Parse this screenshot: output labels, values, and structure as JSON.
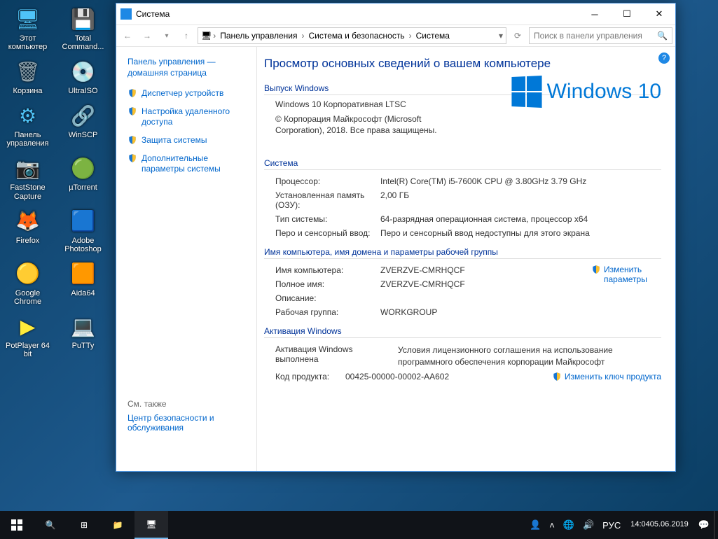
{
  "desktop_icons": [
    {
      "label": "Этот компьютер"
    },
    {
      "label": "Total Command..."
    },
    {
      "label": "Корзина"
    },
    {
      "label": "UltraISO"
    },
    {
      "label": "Панель управления"
    },
    {
      "label": "WinSCP"
    },
    {
      "label": "FastStone Capture"
    },
    {
      "label": "µTorrent"
    },
    {
      "label": "Firefox"
    },
    {
      "label": "Adobe Photoshop"
    },
    {
      "label": "Google Chrome"
    },
    {
      "label": "Aida64"
    },
    {
      "label": "PotPlayer 64 bit"
    },
    {
      "label": "PuTTy"
    }
  ],
  "window": {
    "title": "Система",
    "breadcrumb": [
      "Панель управления",
      "Система и безопасность",
      "Система"
    ],
    "search_placeholder": "Поиск в панели управления"
  },
  "sidebar": {
    "home": "Панель управления — домашняя страница",
    "links": [
      "Диспетчер устройств",
      "Настройка удаленного доступа",
      "Защита системы",
      "Дополнительные параметры системы"
    ],
    "see_also_header": "См. также",
    "see_also_link": "Центр безопасности и обслуживания"
  },
  "main": {
    "heading": "Просмотр основных сведений о вашем компьютере",
    "edition_title": "Выпуск Windows",
    "edition_name": "Windows 10 Корпоративная LTSC",
    "copyright": "© Корпорация Майкрософт (Microsoft Corporation), 2018. Все права защищены.",
    "logo_text": "Windows 10",
    "system_title": "Система",
    "system": [
      {
        "k": "Процессор:",
        "v": "Intel(R) Core(TM) i5-7600K CPU @ 3.80GHz   3.79 GHz"
      },
      {
        "k": "Установленная память (ОЗУ):",
        "v": "2,00 ГБ"
      },
      {
        "k": "Тип системы:",
        "v": "64-разрядная операционная система, процессор x64"
      },
      {
        "k": "Перо и сенсорный ввод:",
        "v": "Перо и сенсорный ввод недоступны для этого экрана"
      }
    ],
    "name_title": "Имя компьютера, имя домена и параметры рабочей группы",
    "name": [
      {
        "k": "Имя компьютера:",
        "v": "ZVERZVE-CMRHQCF"
      },
      {
        "k": "Полное имя:",
        "v": "ZVERZVE-CMRHQCF"
      },
      {
        "k": "Описание:",
        "v": ""
      },
      {
        "k": "Рабочая группа:",
        "v": "WORKGROUP"
      }
    ],
    "change_settings": "Изменить параметры",
    "activation_title": "Активация Windows",
    "activation_status": "Активация Windows выполнена",
    "activation_terms": "Условия лицензионного соглашения на использование программного обеспечения корпорации Майкрософт",
    "product_key_label": "Код продукта:",
    "product_key": "00425-00000-00002-AA602",
    "change_key": "Изменить ключ продукта"
  },
  "taskbar": {
    "lang": "РУС",
    "time": "14:04",
    "date": "05.06.2019"
  }
}
